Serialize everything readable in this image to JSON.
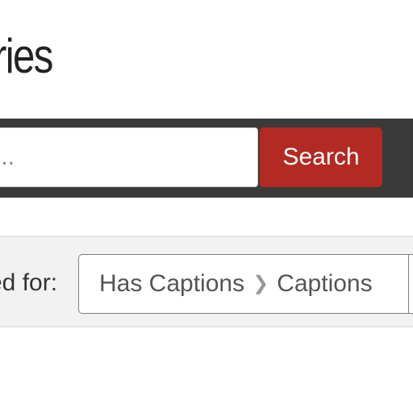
{
  "page": {
    "title": "ries"
  },
  "search": {
    "placeholder": "...",
    "value": "",
    "button_label": "Search"
  },
  "filters": {
    "label": "ed for:",
    "constraint": {
      "field": "Has Captions",
      "separator": "❯",
      "value": "Captions"
    }
  },
  "colors": {
    "search_bar_bg": "#3a3a3a",
    "search_button": "#b22a22",
    "filter_bar_bg": "#f2f2f2"
  }
}
